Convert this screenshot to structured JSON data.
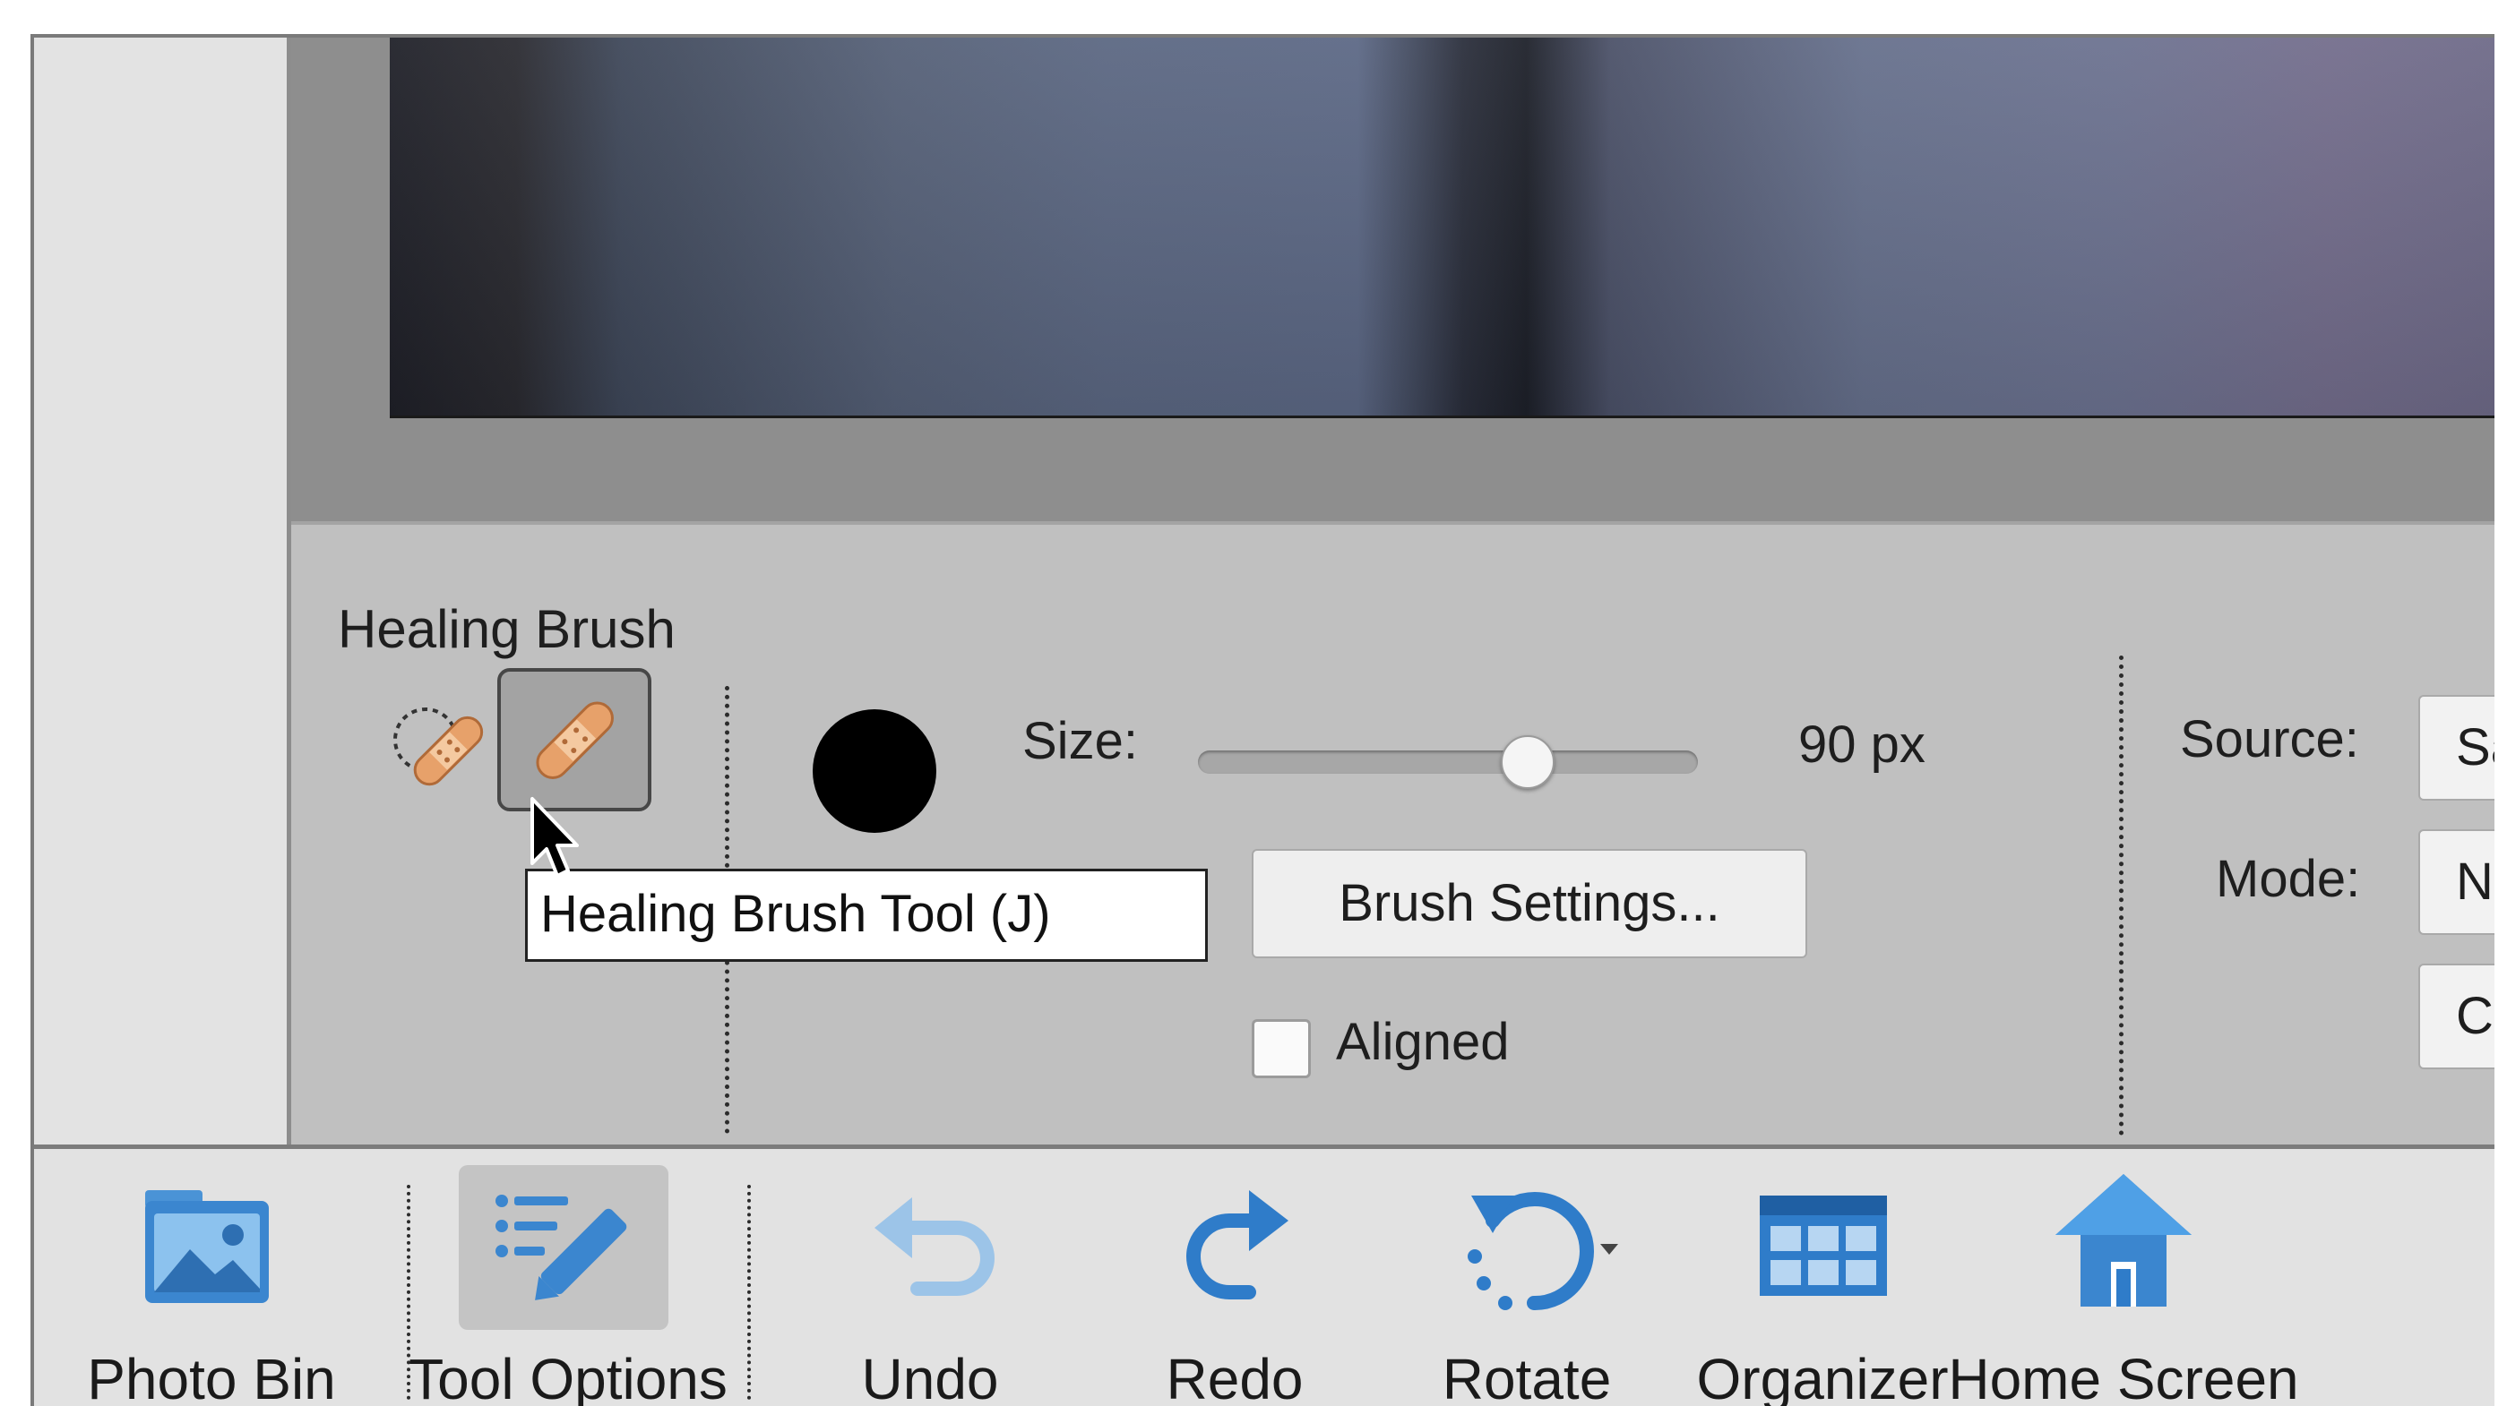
{
  "options_panel": {
    "tool_name": "Healing Brush",
    "size_label": "Size:",
    "size_value": "90 px",
    "size_slider_fraction": 0.66,
    "brush_settings_label": "Brush Settings...",
    "aligned_label": "Aligned",
    "aligned_checked": false,
    "source_label": "Source:",
    "source_value": "Sa",
    "mode_label": "Mode:",
    "mode_value": "No",
    "extra_button_value": "C"
  },
  "tooltip": {
    "text": "Healing Brush Tool (J)"
  },
  "taskbar": {
    "photo_bin": "Photo Bin",
    "tool_options": "Tool Options",
    "undo": "Undo",
    "redo": "Redo",
    "rotate": "Rotate",
    "organizer": "Organizer",
    "home_screen": "Home Screen"
  },
  "colors": {
    "accent_blue": "#2f7cc9",
    "bandage": "#e7a16a",
    "options_bg": "#c0c0c0",
    "taskbar_bg": "#e2e2e2"
  },
  "icons": {
    "spot_healing": "spot-healing-brush-icon",
    "healing": "healing-brush-icon",
    "photo_bin": "photo-bin-icon",
    "tool_options": "tool-options-icon",
    "undo": "undo-icon",
    "redo": "redo-icon",
    "rotate": "rotate-icon",
    "organizer": "organizer-icon",
    "home_screen": "home-icon"
  }
}
